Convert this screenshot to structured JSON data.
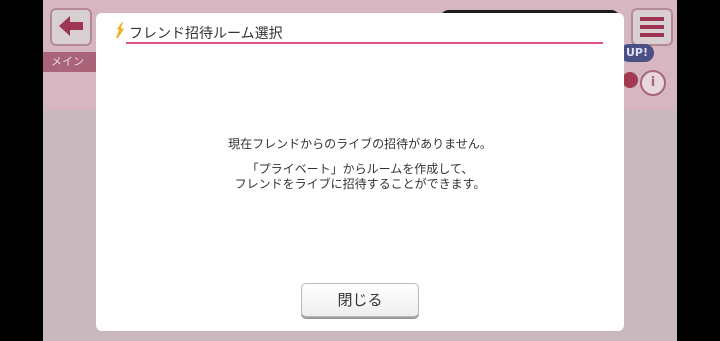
{
  "background": {
    "main_tab_label": "メイン",
    "up_badge": "UP!",
    "info_label": "i"
  },
  "dialog": {
    "title": "フレンド招待ルーム選択",
    "message_line1": "現在フレンドからのライブの招待がありません。",
    "message_line2": "「プライベート」からルームを作成して、",
    "message_line3": "フレンドをライブに招待することができます。",
    "close_label": "閉じる"
  },
  "colors": {
    "accent": "#e0537c",
    "title_icon": "#f0b429"
  }
}
